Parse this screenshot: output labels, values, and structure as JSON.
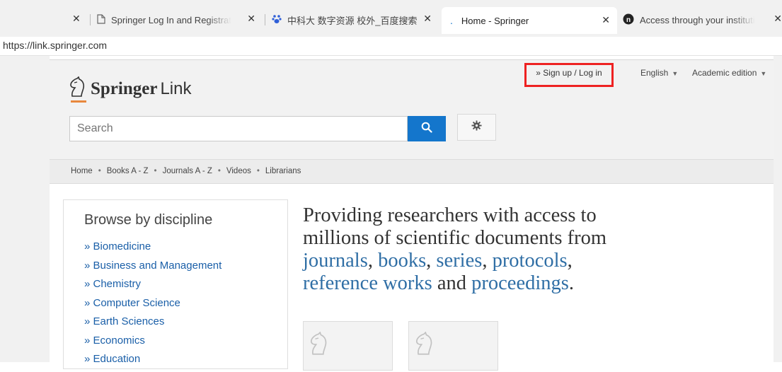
{
  "browser": {
    "tabs": [
      {
        "label": "",
        "close": "✕"
      },
      {
        "label": "Springer Log In and Registrat",
        "close": "✕"
      },
      {
        "label": "中科大 数字资源 校外_百度搜索",
        "close": "✕"
      },
      {
        "label": "Home - Springer",
        "close": "✕"
      },
      {
        "label": "Access through your instituti",
        "close": "✕"
      }
    ],
    "url": "https://link.springer.com"
  },
  "header": {
    "logo_springer": "Springer",
    "logo_link": "Link",
    "signup": "» Sign up / Log in",
    "language": "English",
    "edition": "Academic edition",
    "search_placeholder": "Search"
  },
  "nav": {
    "items": [
      "Home",
      "Books A - Z",
      "Journals A - Z",
      "Videos",
      "Librarians"
    ],
    "separator": "•"
  },
  "browse": {
    "title": "Browse by discipline",
    "items": [
      "» Biomedicine",
      "» Business and Management",
      "» Chemistry",
      "» Computer Science",
      "» Earth Sciences",
      "» Economics",
      "» Education"
    ]
  },
  "hero": {
    "line1": "Providing researchers with access to",
    "line2": "millions of scientific documents from",
    "journals": "journals",
    "books": "books",
    "series": "series",
    "protocols": "protocols",
    "reference_works": "reference works",
    "and": "and",
    "proceedings": "proceedings",
    "comma": ",",
    "period": "."
  },
  "colors": {
    "accent_blue": "#1476cc",
    "link_blue": "#2f6ea5",
    "highlight_red": "#ee2222",
    "logo_orange": "#e8883d"
  }
}
